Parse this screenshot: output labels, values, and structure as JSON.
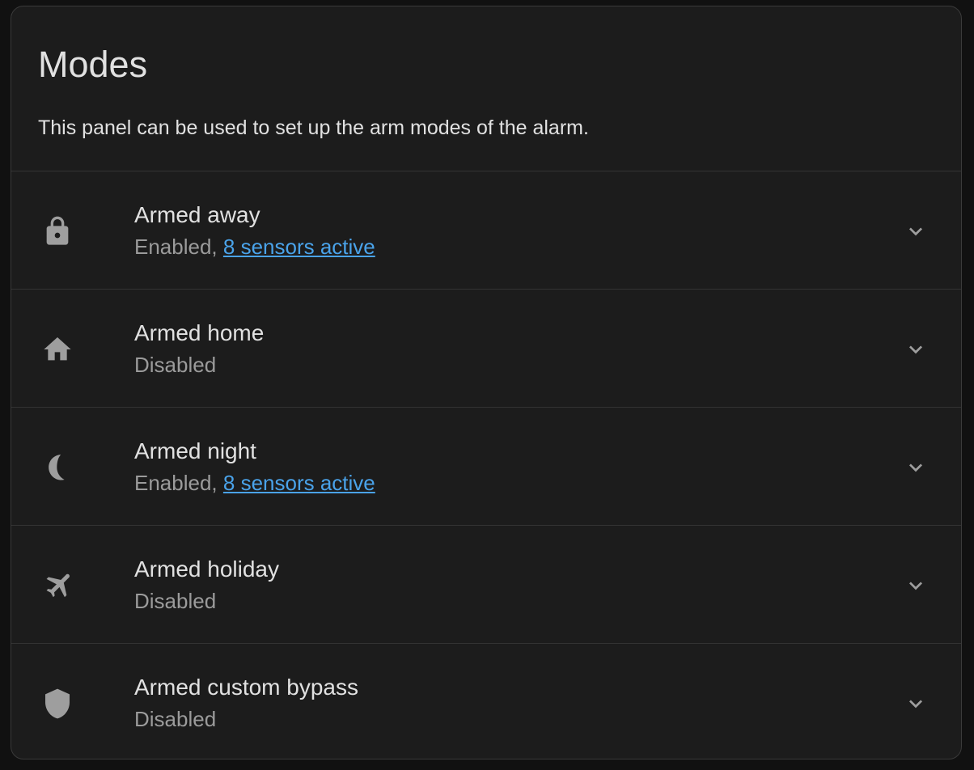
{
  "panel": {
    "title": "Modes",
    "description": "This panel can be used to set up the arm modes of the alarm."
  },
  "colors": {
    "background": "#1c1c1c",
    "text": "#e1e1e1",
    "secondary_text": "#9b9b9b",
    "link": "#4aa3ea",
    "icon": "#9e9e9e"
  },
  "modes": [
    {
      "name": "Armed away",
      "icon": "lock-icon",
      "status": "Enabled,",
      "link": "8 sensors active"
    },
    {
      "name": "Armed home",
      "icon": "home-icon",
      "status": "Disabled",
      "link": ""
    },
    {
      "name": "Armed night",
      "icon": "moon-icon",
      "status": "Enabled,",
      "link": "8 sensors active"
    },
    {
      "name": "Armed holiday",
      "icon": "airplane-icon",
      "status": "Disabled",
      "link": ""
    },
    {
      "name": "Armed custom bypass",
      "icon": "shield-icon",
      "status": "Disabled",
      "link": ""
    }
  ]
}
